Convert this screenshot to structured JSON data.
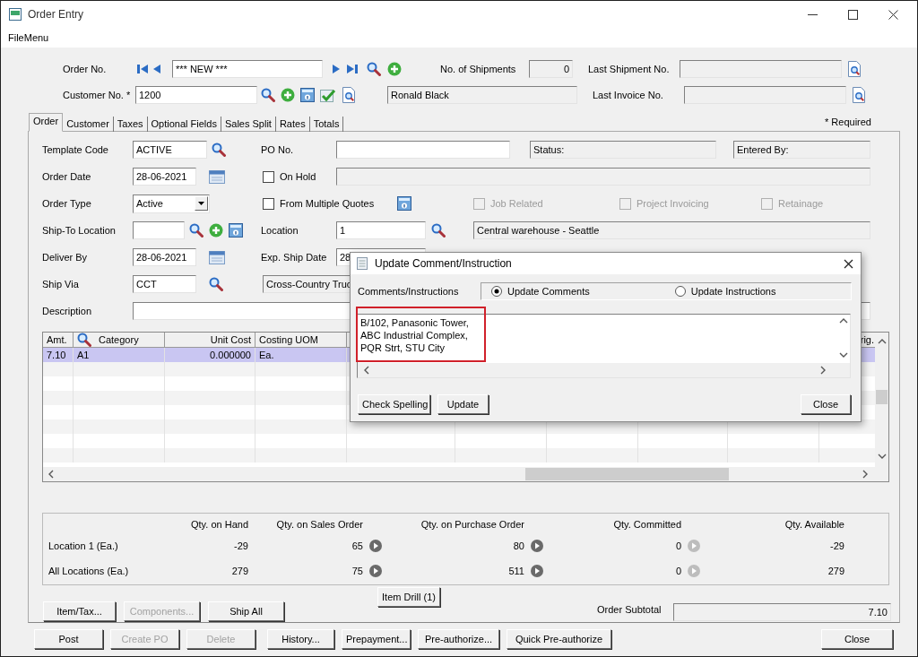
{
  "window": {
    "title": "Order Entry"
  },
  "menu": [
    "FileMenu"
  ],
  "header": {
    "order_no_label": "Order No.",
    "order_no": "*** NEW ***",
    "shipments_label": "No. of Shipments",
    "shipments": "0",
    "last_shipment_label": "Last Shipment No.",
    "customer_no_label": "Customer No. *",
    "customer_no": "1200",
    "customer_name": "Ronald Black",
    "last_invoice_label": "Last Invoice No."
  },
  "tabs": [
    {
      "label": "Order",
      "selected": true
    },
    {
      "label": "Customer",
      "selected": false
    },
    {
      "label": "Taxes",
      "selected": false
    },
    {
      "label": "Optional Fields",
      "selected": false
    },
    {
      "label": "Sales Split",
      "selected": false
    },
    {
      "label": "Rates",
      "selected": false
    },
    {
      "label": "Totals",
      "selected": false
    }
  ],
  "required_note": "* Required",
  "order_tab": {
    "template_code_label": "Template Code",
    "template_code": "ACTIVE",
    "po_label": "PO No.",
    "status_field": "Status:",
    "entered_by_field": "Entered By:",
    "order_date_label": "Order Date",
    "order_date": "28-06-2021",
    "on_hold": {
      "label": "On Hold",
      "checked": false
    },
    "order_type_label": "Order Type",
    "order_type": "Active",
    "multiple_quotes": {
      "label": "From Multiple Quotes",
      "checked": false
    },
    "job_options": [
      {
        "label": "Job Related",
        "checked": false,
        "disabled": true
      },
      {
        "label": "Project Invoicing",
        "checked": false,
        "disabled": true
      },
      {
        "label": "Retainage",
        "checked": false,
        "disabled": true
      }
    ],
    "ship_to_label": "Ship-To Location",
    "location_label": "Location",
    "location": "1",
    "location_name": "Central warehouse - Seattle",
    "deliver_by_label": "Deliver By",
    "deliver_by": "28-06-2021",
    "exp_ship_label": "Exp. Ship Date",
    "exp_ship": "28",
    "ship_via_label": "Ship Via",
    "ship_via": "CCT",
    "ship_via_name": "Cross-Country Truc",
    "description_label": "Description"
  },
  "grid": {
    "columns": [
      {
        "label": "Amt.",
        "kind": "text"
      },
      {
        "label": "Category",
        "kind": "lookup"
      },
      {
        "label": "Unit Cost",
        "kind": "number"
      },
      {
        "label": "Costing UOM",
        "kind": "text"
      },
      {
        "label": "rig.",
        "kind": "number"
      }
    ],
    "rows": [
      {
        "cells": [
          "7.10",
          "A1",
          "0.000000",
          "Ea."
        ],
        "selected": true
      }
    ]
  },
  "stock": {
    "columns": [
      {
        "label": "Qty. on Hand",
        "kind": "plain"
      },
      {
        "label": "Qty. on Sales Order",
        "kind": "drill",
        "disabled": false
      },
      {
        "label": "Qty. on Purchase Order",
        "kind": "drill",
        "disabled": false
      },
      {
        "label": "Qty. Committed",
        "kind": "drill",
        "disabled": true
      },
      {
        "label": "Qty. Available",
        "kind": "plain"
      }
    ],
    "rows": [
      {
        "label": "Location 1 (Ea.)",
        "values": [
          "-29",
          "65",
          "80",
          "0",
          "-29"
        ]
      },
      {
        "label": "All Locations (Ea.)",
        "values": [
          "279",
          "75",
          "511",
          "0",
          "279"
        ]
      }
    ]
  },
  "item_buttons": [
    {
      "label": "Item/Tax...",
      "disabled": false
    },
    {
      "label": "Components...",
      "disabled": true
    },
    {
      "label": "Ship All",
      "disabled": false
    }
  ],
  "item_drill_button": "Item Drill (1)",
  "subtotal": {
    "label": "Order Subtotal",
    "value": "7.10"
  },
  "actions": [
    {
      "label": "Post",
      "disabled": false
    },
    {
      "label": "Create PO",
      "disabled": true
    },
    {
      "label": "Delete",
      "disabled": true
    },
    {
      "label": "History...",
      "disabled": false
    },
    {
      "label": "Prepayment...",
      "disabled": false
    },
    {
      "label": "Pre-authorize...",
      "disabled": false
    },
    {
      "label": "Quick Pre-authorize",
      "disabled": false
    }
  ],
  "close_button": "Close",
  "dialog": {
    "title": "Update Comment/Instruction",
    "label": "Comments/Instructions",
    "modes": [
      {
        "label": "Update Comments",
        "selected": true
      },
      {
        "label": "Update Instructions",
        "selected": false
      }
    ],
    "text": "B/102, Panasonic Tower,\nABC Industrial Complex,\nPQR Strt, STU City",
    "buttons": [
      "Check Spelling",
      "Update"
    ],
    "close_button": "Close"
  }
}
